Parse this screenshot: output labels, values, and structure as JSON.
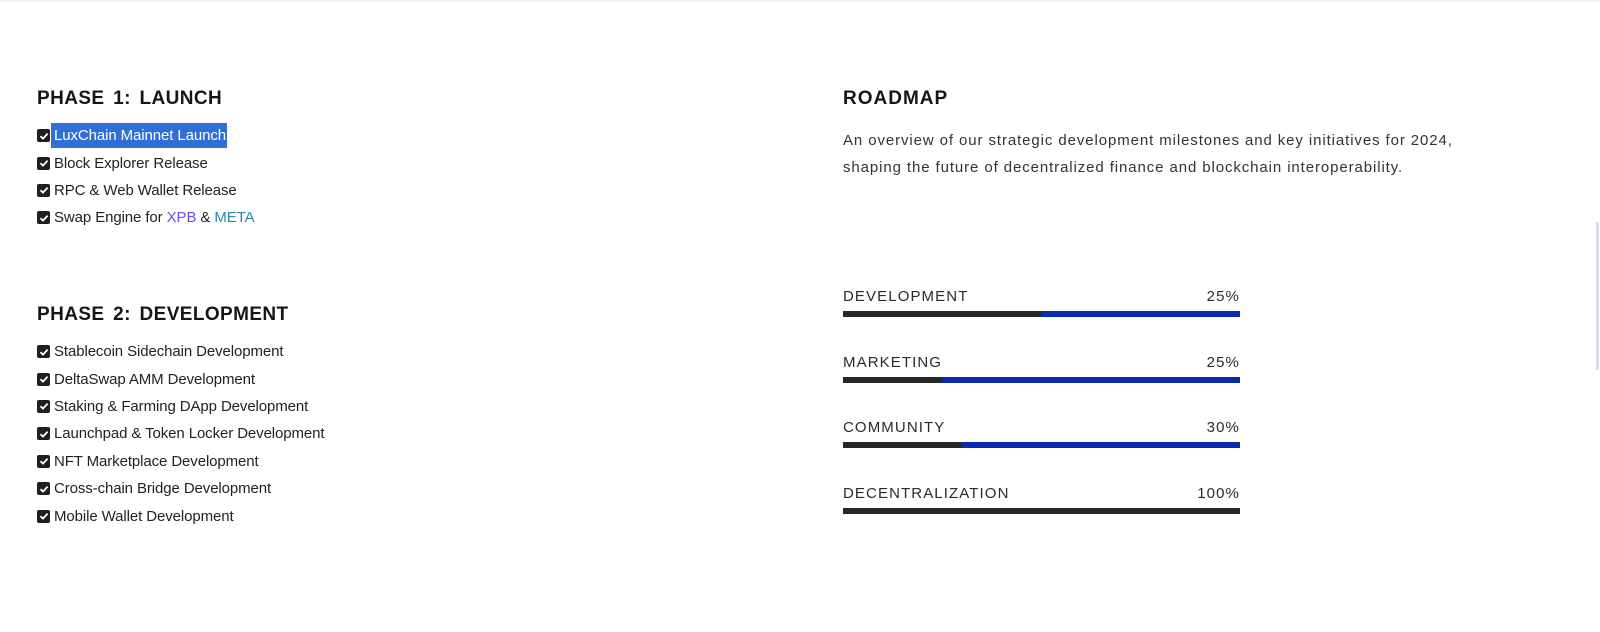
{
  "phase1": {
    "title": "PHASE 1: LAUNCH",
    "items": [
      {
        "label": "LuxChain Mainnet Launch",
        "checked": true,
        "selected": true
      },
      {
        "label": "Block Explorer Release",
        "checked": true
      },
      {
        "label": "RPC & Web Wallet Release",
        "checked": true
      },
      {
        "label_prefix": "Swap Engine for ",
        "link1": "XPB",
        "joiner": " & ",
        "link2": "META",
        "checked": true
      }
    ]
  },
  "phase2": {
    "title": "PHASE 2: DEVELOPMENT",
    "items": [
      {
        "label": "Stablecoin Sidechain Development",
        "checked": true
      },
      {
        "label": "DeltaSwap AMM Development",
        "checked": true
      },
      {
        "label": "Staking & Farming DApp Development",
        "checked": true
      },
      {
        "label": "Launchpad & Token Locker Development",
        "checked": true
      },
      {
        "label": "NFT Marketplace Development",
        "checked": true
      },
      {
        "label": "Cross-chain Bridge Development",
        "checked": true
      },
      {
        "label": "Mobile Wallet Development",
        "checked": true
      }
    ]
  },
  "roadmap": {
    "title": "ROADMAP",
    "description": "An overview of our strategic development milestones and key initiatives for 2024, shaping the future of decentralized finance and blockchain interoperability.",
    "progress": [
      {
        "label": "DEVELOPMENT",
        "value_text": "25%",
        "fill_fraction": 0.5
      },
      {
        "label": "MARKETING",
        "value_text": "25%",
        "fill_fraction": 0.25
      },
      {
        "label": "COMMUNITY",
        "value_text": "30%",
        "fill_fraction": 0.3
      },
      {
        "label": "DECENTRALIZATION",
        "value_text": "100%",
        "fill_fraction": 1.0
      }
    ]
  },
  "colors": {
    "selection": "#2f6fd6",
    "link_xpb": "#6a52e8",
    "link_meta": "#2b86a7",
    "bar_track": "#0a2cb0",
    "bar_fill": "#272727"
  }
}
